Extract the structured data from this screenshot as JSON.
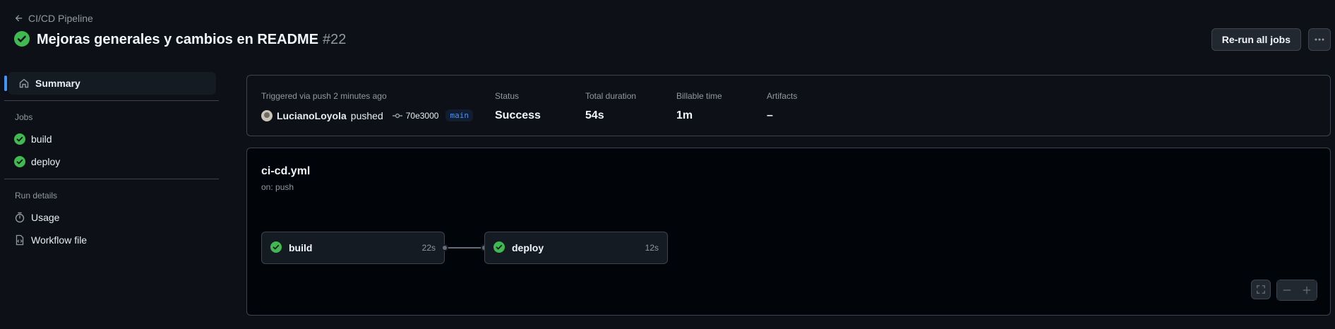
{
  "header": {
    "back_label": "CI/CD Pipeline",
    "title": "Mejoras generales y cambios en README",
    "run_number": "#22",
    "rerun_label": "Re-run all jobs"
  },
  "sidebar": {
    "summary_label": "Summary",
    "jobs_heading": "Jobs",
    "jobs": [
      {
        "label": "build"
      },
      {
        "label": "deploy"
      }
    ],
    "run_details_heading": "Run details",
    "usage_label": "Usage",
    "workflow_file_label": "Workflow file"
  },
  "summary": {
    "trigger_label": "Triggered via push 2 minutes ago",
    "actor": "LucianoLoyola",
    "action": "pushed",
    "commit": "70e3000",
    "branch": "main",
    "status_label": "Status",
    "status_value": "Success",
    "duration_label": "Total duration",
    "duration_value": "54s",
    "billable_label": "Billable time",
    "billable_value": "1m",
    "artifacts_label": "Artifacts",
    "artifacts_value": "–"
  },
  "workflow": {
    "file": "ci-cd.yml",
    "trigger": "on: push",
    "jobs": [
      {
        "name": "build",
        "duration": "22s"
      },
      {
        "name": "deploy",
        "duration": "12s"
      }
    ]
  },
  "colors": {
    "success": "#3fb950",
    "accent": "#4493f8"
  }
}
